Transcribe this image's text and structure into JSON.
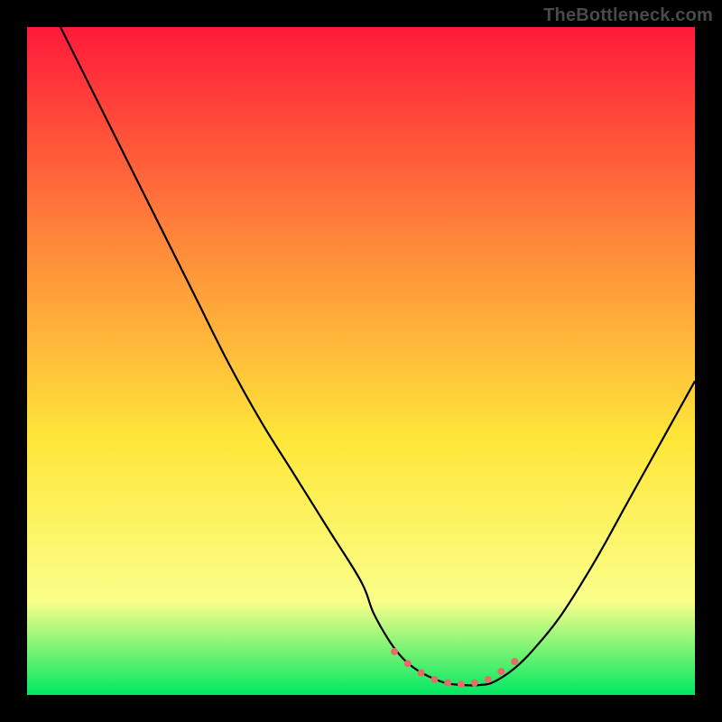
{
  "watermark": "TheBottleneck.com",
  "chart_data": {
    "type": "line",
    "title": "",
    "xlabel": "",
    "ylabel": "",
    "xlim": [
      0,
      100
    ],
    "ylim": [
      0,
      100
    ],
    "grid": false,
    "gradient_colors": {
      "top": "#ff1a3a",
      "mid_upper": "#ff913a",
      "mid": "#ffe73a",
      "mid_lower": "#faff8a",
      "bottom": "#00e861"
    },
    "series": [
      {
        "name": "bottleneck-curve",
        "x": [
          5,
          10,
          15,
          20,
          25,
          30,
          35,
          40,
          45,
          50,
          52,
          55,
          58,
          62,
          65,
          68,
          70,
          73,
          76,
          80,
          85,
          90,
          95,
          100
        ],
        "y": [
          100,
          90,
          80,
          70,
          60,
          50,
          41,
          33,
          25,
          17,
          12,
          7,
          4,
          2,
          1.5,
          1.5,
          2,
          4,
          7,
          12,
          20,
          29,
          38,
          47
        ]
      }
    ],
    "markers": {
      "name": "plateau-dots",
      "color": "#e86a6a",
      "radius": 4,
      "x": [
        55,
        57,
        59,
        61,
        63,
        65,
        67,
        69,
        71,
        73
      ],
      "y": [
        6.5,
        4.7,
        3.3,
        2.3,
        1.8,
        1.6,
        1.8,
        2.3,
        3.5,
        5.0
      ]
    }
  }
}
